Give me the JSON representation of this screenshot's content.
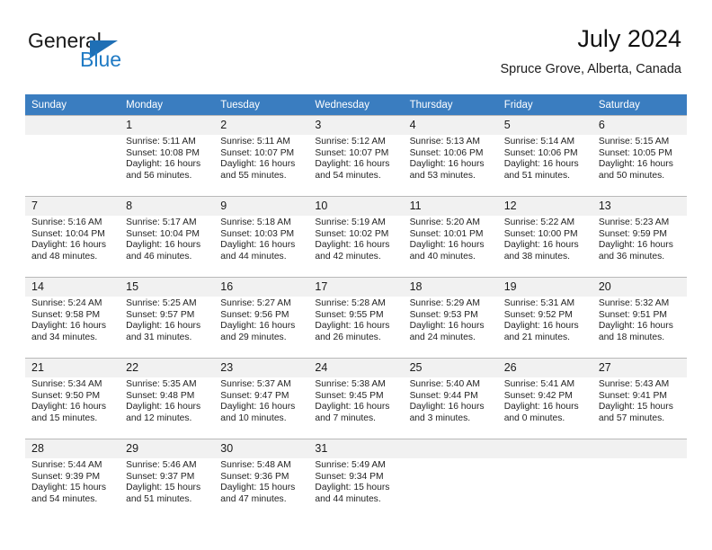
{
  "brand": {
    "word1": "General",
    "word2": "Blue",
    "accent_color": "#1f7ac4",
    "triangle_color": "#1f6fb5"
  },
  "header": {
    "title": "July 2024",
    "subtitle": "Spruce Grove, Alberta, Canada"
  },
  "calendar": {
    "header_bg": "#3a7dc0",
    "daynum_bg": "#f1f1f1",
    "weekday_headers": [
      "Sunday",
      "Monday",
      "Tuesday",
      "Wednesday",
      "Thursday",
      "Friday",
      "Saturday"
    ],
    "weeks": [
      [
        {
          "day": "",
          "sunrise": "",
          "sunset": "",
          "daylight_line1": "",
          "daylight_line2": ""
        },
        {
          "day": "1",
          "sunrise": "Sunrise: 5:11 AM",
          "sunset": "Sunset: 10:08 PM",
          "daylight_line1": "Daylight: 16 hours",
          "daylight_line2": "and 56 minutes."
        },
        {
          "day": "2",
          "sunrise": "Sunrise: 5:11 AM",
          "sunset": "Sunset: 10:07 PM",
          "daylight_line1": "Daylight: 16 hours",
          "daylight_line2": "and 55 minutes."
        },
        {
          "day": "3",
          "sunrise": "Sunrise: 5:12 AM",
          "sunset": "Sunset: 10:07 PM",
          "daylight_line1": "Daylight: 16 hours",
          "daylight_line2": "and 54 minutes."
        },
        {
          "day": "4",
          "sunrise": "Sunrise: 5:13 AM",
          "sunset": "Sunset: 10:06 PM",
          "daylight_line1": "Daylight: 16 hours",
          "daylight_line2": "and 53 minutes."
        },
        {
          "day": "5",
          "sunrise": "Sunrise: 5:14 AM",
          "sunset": "Sunset: 10:06 PM",
          "daylight_line1": "Daylight: 16 hours",
          "daylight_line2": "and 51 minutes."
        },
        {
          "day": "6",
          "sunrise": "Sunrise: 5:15 AM",
          "sunset": "Sunset: 10:05 PM",
          "daylight_line1": "Daylight: 16 hours",
          "daylight_line2": "and 50 minutes."
        }
      ],
      [
        {
          "day": "7",
          "sunrise": "Sunrise: 5:16 AM",
          "sunset": "Sunset: 10:04 PM",
          "daylight_line1": "Daylight: 16 hours",
          "daylight_line2": "and 48 minutes."
        },
        {
          "day": "8",
          "sunrise": "Sunrise: 5:17 AM",
          "sunset": "Sunset: 10:04 PM",
          "daylight_line1": "Daylight: 16 hours",
          "daylight_line2": "and 46 minutes."
        },
        {
          "day": "9",
          "sunrise": "Sunrise: 5:18 AM",
          "sunset": "Sunset: 10:03 PM",
          "daylight_line1": "Daylight: 16 hours",
          "daylight_line2": "and 44 minutes."
        },
        {
          "day": "10",
          "sunrise": "Sunrise: 5:19 AM",
          "sunset": "Sunset: 10:02 PM",
          "daylight_line1": "Daylight: 16 hours",
          "daylight_line2": "and 42 minutes."
        },
        {
          "day": "11",
          "sunrise": "Sunrise: 5:20 AM",
          "sunset": "Sunset: 10:01 PM",
          "daylight_line1": "Daylight: 16 hours",
          "daylight_line2": "and 40 minutes."
        },
        {
          "day": "12",
          "sunrise": "Sunrise: 5:22 AM",
          "sunset": "Sunset: 10:00 PM",
          "daylight_line1": "Daylight: 16 hours",
          "daylight_line2": "and 38 minutes."
        },
        {
          "day": "13",
          "sunrise": "Sunrise: 5:23 AM",
          "sunset": "Sunset: 9:59 PM",
          "daylight_line1": "Daylight: 16 hours",
          "daylight_line2": "and 36 minutes."
        }
      ],
      [
        {
          "day": "14",
          "sunrise": "Sunrise: 5:24 AM",
          "sunset": "Sunset: 9:58 PM",
          "daylight_line1": "Daylight: 16 hours",
          "daylight_line2": "and 34 minutes."
        },
        {
          "day": "15",
          "sunrise": "Sunrise: 5:25 AM",
          "sunset": "Sunset: 9:57 PM",
          "daylight_line1": "Daylight: 16 hours",
          "daylight_line2": "and 31 minutes."
        },
        {
          "day": "16",
          "sunrise": "Sunrise: 5:27 AM",
          "sunset": "Sunset: 9:56 PM",
          "daylight_line1": "Daylight: 16 hours",
          "daylight_line2": "and 29 minutes."
        },
        {
          "day": "17",
          "sunrise": "Sunrise: 5:28 AM",
          "sunset": "Sunset: 9:55 PM",
          "daylight_line1": "Daylight: 16 hours",
          "daylight_line2": "and 26 minutes."
        },
        {
          "day": "18",
          "sunrise": "Sunrise: 5:29 AM",
          "sunset": "Sunset: 9:53 PM",
          "daylight_line1": "Daylight: 16 hours",
          "daylight_line2": "and 24 minutes."
        },
        {
          "day": "19",
          "sunrise": "Sunrise: 5:31 AM",
          "sunset": "Sunset: 9:52 PM",
          "daylight_line1": "Daylight: 16 hours",
          "daylight_line2": "and 21 minutes."
        },
        {
          "day": "20",
          "sunrise": "Sunrise: 5:32 AM",
          "sunset": "Sunset: 9:51 PM",
          "daylight_line1": "Daylight: 16 hours",
          "daylight_line2": "and 18 minutes."
        }
      ],
      [
        {
          "day": "21",
          "sunrise": "Sunrise: 5:34 AM",
          "sunset": "Sunset: 9:50 PM",
          "daylight_line1": "Daylight: 16 hours",
          "daylight_line2": "and 15 minutes."
        },
        {
          "day": "22",
          "sunrise": "Sunrise: 5:35 AM",
          "sunset": "Sunset: 9:48 PM",
          "daylight_line1": "Daylight: 16 hours",
          "daylight_line2": "and 12 minutes."
        },
        {
          "day": "23",
          "sunrise": "Sunrise: 5:37 AM",
          "sunset": "Sunset: 9:47 PM",
          "daylight_line1": "Daylight: 16 hours",
          "daylight_line2": "and 10 minutes."
        },
        {
          "day": "24",
          "sunrise": "Sunrise: 5:38 AM",
          "sunset": "Sunset: 9:45 PM",
          "daylight_line1": "Daylight: 16 hours",
          "daylight_line2": "and 7 minutes."
        },
        {
          "day": "25",
          "sunrise": "Sunrise: 5:40 AM",
          "sunset": "Sunset: 9:44 PM",
          "daylight_line1": "Daylight: 16 hours",
          "daylight_line2": "and 3 minutes."
        },
        {
          "day": "26",
          "sunrise": "Sunrise: 5:41 AM",
          "sunset": "Sunset: 9:42 PM",
          "daylight_line1": "Daylight: 16 hours",
          "daylight_line2": "and 0 minutes."
        },
        {
          "day": "27",
          "sunrise": "Sunrise: 5:43 AM",
          "sunset": "Sunset: 9:41 PM",
          "daylight_line1": "Daylight: 15 hours",
          "daylight_line2": "and 57 minutes."
        }
      ],
      [
        {
          "day": "28",
          "sunrise": "Sunrise: 5:44 AM",
          "sunset": "Sunset: 9:39 PM",
          "daylight_line1": "Daylight: 15 hours",
          "daylight_line2": "and 54 minutes."
        },
        {
          "day": "29",
          "sunrise": "Sunrise: 5:46 AM",
          "sunset": "Sunset: 9:37 PM",
          "daylight_line1": "Daylight: 15 hours",
          "daylight_line2": "and 51 minutes."
        },
        {
          "day": "30",
          "sunrise": "Sunrise: 5:48 AM",
          "sunset": "Sunset: 9:36 PM",
          "daylight_line1": "Daylight: 15 hours",
          "daylight_line2": "and 47 minutes."
        },
        {
          "day": "31",
          "sunrise": "Sunrise: 5:49 AM",
          "sunset": "Sunset: 9:34 PM",
          "daylight_line1": "Daylight: 15 hours",
          "daylight_line2": "and 44 minutes."
        },
        {
          "day": "",
          "sunrise": "",
          "sunset": "",
          "daylight_line1": "",
          "daylight_line2": ""
        },
        {
          "day": "",
          "sunrise": "",
          "sunset": "",
          "daylight_line1": "",
          "daylight_line2": ""
        },
        {
          "day": "",
          "sunrise": "",
          "sunset": "",
          "daylight_line1": "",
          "daylight_line2": ""
        }
      ]
    ]
  }
}
